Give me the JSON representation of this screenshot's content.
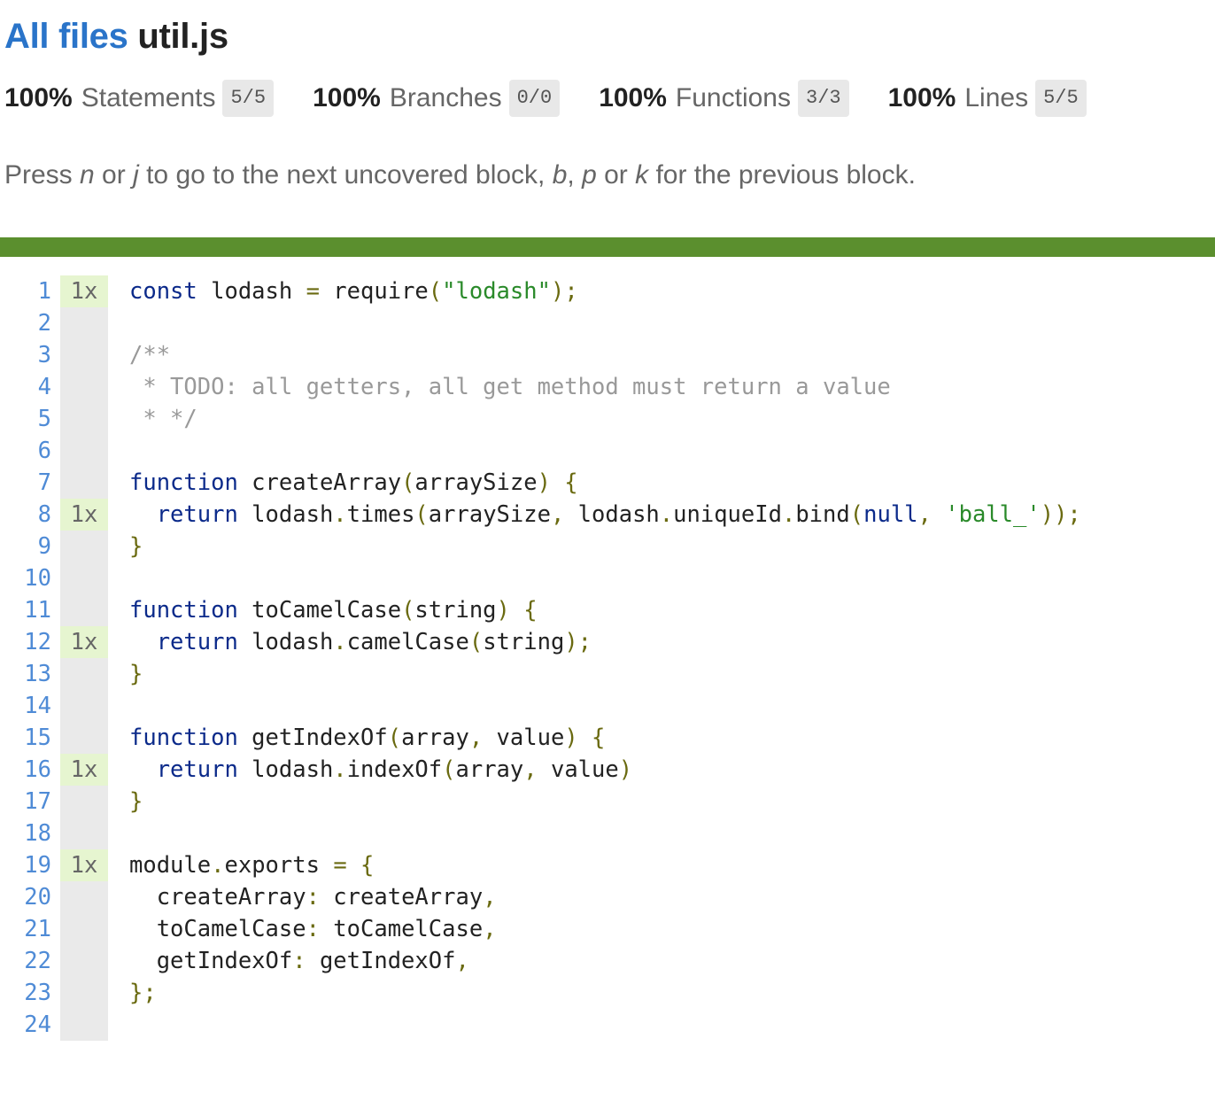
{
  "header": {
    "link_label": "All files",
    "file_name": "util.js"
  },
  "stats": [
    {
      "pct": "100%",
      "label": "Statements",
      "fraction": "5/5"
    },
    {
      "pct": "100%",
      "label": "Branches",
      "fraction": "0/0"
    },
    {
      "pct": "100%",
      "label": "Functions",
      "fraction": "3/3"
    },
    {
      "pct": "100%",
      "label": "Lines",
      "fraction": "5/5"
    }
  ],
  "hint": {
    "p1": "Press ",
    "n": "n",
    "p2": " or ",
    "j": "j",
    "p3": " to go to the next uncovered block, ",
    "b": "b",
    "p4": ", ",
    "p": "p",
    "p5": " or ",
    "k": "k",
    "p6": " for the previous block."
  },
  "coverage_bar_color": "#5b8f2e",
  "code": [
    {
      "n": "1",
      "hits": "1x",
      "tokens": [
        [
          "kw",
          "const"
        ],
        [
          "id",
          " lodash "
        ],
        [
          "pun",
          "="
        ],
        [
          "id",
          " require"
        ],
        [
          "pun",
          "("
        ],
        [
          "str",
          "\"lodash\""
        ],
        [
          "pun",
          ");"
        ]
      ]
    },
    {
      "n": "2",
      "hits": "",
      "tokens": []
    },
    {
      "n": "3",
      "hits": "",
      "tokens": [
        [
          "com",
          "/**"
        ]
      ]
    },
    {
      "n": "4",
      "hits": "",
      "tokens": [
        [
          "com",
          " * TODO: all getters, all get method must return a value"
        ]
      ]
    },
    {
      "n": "5",
      "hits": "",
      "tokens": [
        [
          "com",
          " * */"
        ]
      ]
    },
    {
      "n": "6",
      "hits": "",
      "tokens": []
    },
    {
      "n": "7",
      "hits": "",
      "tokens": [
        [
          "kw",
          "function"
        ],
        [
          "id",
          " createArray"
        ],
        [
          "pun",
          "("
        ],
        [
          "id",
          "arraySize"
        ],
        [
          "pun",
          ") {"
        ]
      ]
    },
    {
      "n": "8",
      "hits": "1x",
      "tokens": [
        [
          "kw",
          "  return"
        ],
        [
          "id",
          " lodash"
        ],
        [
          "pun",
          "."
        ],
        [
          "id",
          "times"
        ],
        [
          "pun",
          "("
        ],
        [
          "id",
          "arraySize"
        ],
        [
          "pun",
          ","
        ],
        [
          "id",
          " lodash"
        ],
        [
          "pun",
          "."
        ],
        [
          "id",
          "uniqueId"
        ],
        [
          "pun",
          "."
        ],
        [
          "id",
          "bind"
        ],
        [
          "pun",
          "("
        ],
        [
          "kw",
          "null"
        ],
        [
          "pun",
          ","
        ],
        [
          "str",
          " 'ball_'"
        ],
        [
          "pun",
          "));"
        ]
      ]
    },
    {
      "n": "9",
      "hits": "",
      "tokens": [
        [
          "pun",
          "}"
        ]
      ]
    },
    {
      "n": "10",
      "hits": "",
      "tokens": []
    },
    {
      "n": "11",
      "hits": "",
      "tokens": [
        [
          "kw",
          "function"
        ],
        [
          "id",
          " toCamelCase"
        ],
        [
          "pun",
          "("
        ],
        [
          "id",
          "string"
        ],
        [
          "pun",
          ") {"
        ]
      ]
    },
    {
      "n": "12",
      "hits": "1x",
      "tokens": [
        [
          "kw",
          "  return"
        ],
        [
          "id",
          " lodash"
        ],
        [
          "pun",
          "."
        ],
        [
          "id",
          "camelCase"
        ],
        [
          "pun",
          "("
        ],
        [
          "id",
          "string"
        ],
        [
          "pun",
          ");"
        ]
      ]
    },
    {
      "n": "13",
      "hits": "",
      "tokens": [
        [
          "pun",
          "}"
        ]
      ]
    },
    {
      "n": "14",
      "hits": "",
      "tokens": []
    },
    {
      "n": "15",
      "hits": "",
      "tokens": [
        [
          "kw",
          "function"
        ],
        [
          "id",
          " getIndexOf"
        ],
        [
          "pun",
          "("
        ],
        [
          "id",
          "array"
        ],
        [
          "pun",
          ","
        ],
        [
          "id",
          " value"
        ],
        [
          "pun",
          ") {"
        ]
      ]
    },
    {
      "n": "16",
      "hits": "1x",
      "tokens": [
        [
          "kw",
          "  return"
        ],
        [
          "id",
          " lodash"
        ],
        [
          "pun",
          "."
        ],
        [
          "id",
          "indexOf"
        ],
        [
          "pun",
          "("
        ],
        [
          "id",
          "array"
        ],
        [
          "pun",
          ","
        ],
        [
          "id",
          " value"
        ],
        [
          "pun",
          ")"
        ]
      ]
    },
    {
      "n": "17",
      "hits": "",
      "tokens": [
        [
          "pun",
          "}"
        ]
      ]
    },
    {
      "n": "18",
      "hits": "",
      "tokens": []
    },
    {
      "n": "19",
      "hits": "1x",
      "tokens": [
        [
          "id",
          "module"
        ],
        [
          "pun",
          "."
        ],
        [
          "id",
          "exports "
        ],
        [
          "pun",
          "= {"
        ]
      ]
    },
    {
      "n": "20",
      "hits": "",
      "tokens": [
        [
          "id",
          "  createArray"
        ],
        [
          "pun",
          ":"
        ],
        [
          "id",
          " createArray"
        ],
        [
          "pun",
          ","
        ]
      ]
    },
    {
      "n": "21",
      "hits": "",
      "tokens": [
        [
          "id",
          "  toCamelCase"
        ],
        [
          "pun",
          ":"
        ],
        [
          "id",
          " toCamelCase"
        ],
        [
          "pun",
          ","
        ]
      ]
    },
    {
      "n": "22",
      "hits": "",
      "tokens": [
        [
          "id",
          "  getIndexOf"
        ],
        [
          "pun",
          ":"
        ],
        [
          "id",
          " getIndexOf"
        ],
        [
          "pun",
          ","
        ]
      ]
    },
    {
      "n": "23",
      "hits": "",
      "tokens": [
        [
          "pun",
          "};"
        ]
      ]
    },
    {
      "n": "24",
      "hits": "",
      "tokens": []
    }
  ]
}
